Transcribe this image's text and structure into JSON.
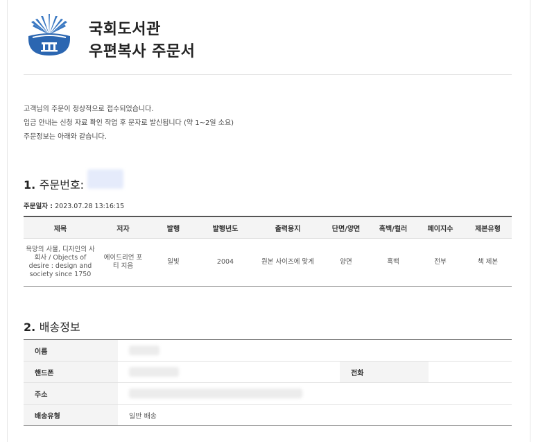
{
  "header": {
    "title_line1": "국회도서관",
    "title_line2": "우편복사 주문서"
  },
  "message": {
    "line1": "고객님의 주문이 정상적으로 접수되었습니다.",
    "line2": "입금 안내는 신청 자료 확인 작업 후 문자로 발신됩니다 (약 1~2일 소요)",
    "line3": "주문정보는 아래와 같습니다."
  },
  "order": {
    "section_number": "1.",
    "section_label": "주문번호:",
    "date_label": "주문일자 :",
    "date_value": "2023.07.28 13:16:15",
    "columns": [
      "제목",
      "저자",
      "발행",
      "발행년도",
      "출력용지",
      "단면/양면",
      "흑백/컬러",
      "페이지수",
      "제본유형"
    ],
    "rows": [
      {
        "title": "욕망의 사물, 디자인의 사회사 / Objects of desire : design and society since 1750",
        "author": "에이드리언 포티 지음",
        "publisher": "일빛",
        "year": "2004",
        "paper": "원본 사이즈에 맞게",
        "sides": "양면",
        "color": "흑백",
        "pages": "전부",
        "binding": "책 제본"
      }
    ]
  },
  "shipping": {
    "section_number": "2.",
    "section_label": "배송정보",
    "name_label": "이름",
    "phone_label": "핸드폰",
    "tel_label": "전화",
    "address_label": "주소",
    "type_label": "배송유형",
    "type_value": "일반 배송"
  },
  "colors": {
    "logo_blue": "#2b66b1",
    "redaction_blue": "#e5ebfb",
    "table_header_bg": "#f4f4f4"
  }
}
